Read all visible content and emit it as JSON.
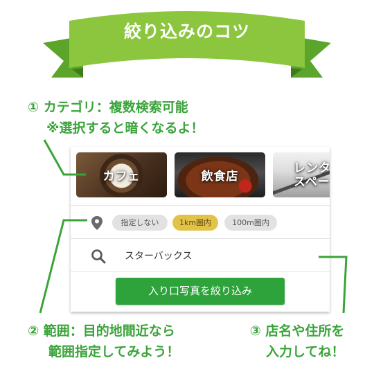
{
  "ribbon": {
    "title": "絞り込みのコツ"
  },
  "tips": {
    "category": {
      "line1": "① カテゴリ：複数検索可能",
      "line2": "※選択すると暗くなるよ！"
    },
    "range": {
      "line1": "② 範囲：目的地間近なら",
      "line2": "範囲指定してみよう！"
    },
    "keyword": {
      "line1": "③ 店名や住所を",
      "line2": "入力してね！"
    }
  },
  "categories": [
    {
      "label": "カフェ"
    },
    {
      "label": "飲食店"
    },
    {
      "label": "レンタ\nスペー"
    }
  ],
  "filter": {
    "icon": "location-pin-icon",
    "chips": [
      {
        "label": "指定しない",
        "selected": false
      },
      {
        "label": "1km圏内",
        "selected": true
      },
      {
        "label": "100m圏内",
        "selected": false
      }
    ]
  },
  "search": {
    "icon": "search-icon",
    "value": "スターバックス"
  },
  "apply_button": {
    "label": "入り口写真を絞り込み"
  },
  "colors": {
    "accent_green": "#3aa43a",
    "button_green": "#2ea33b",
    "chip_selected": "#e3c24a",
    "chip_default": "#e2e2e2"
  }
}
